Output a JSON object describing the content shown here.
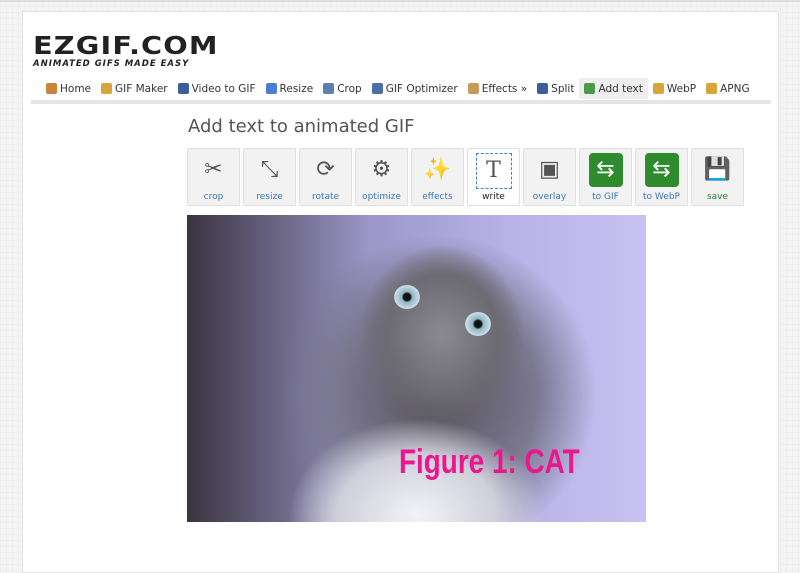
{
  "logo": {
    "name": "EZGIF.COM",
    "tagline": "ANIMATED GIFS MADE EASY"
  },
  "nav": [
    {
      "label": "Home",
      "icon": "home-icon",
      "color": "#c8843a"
    },
    {
      "label": "GIF Maker",
      "icon": "gif-maker-icon",
      "color": "#d9a53a"
    },
    {
      "label": "Video to GIF",
      "icon": "film-icon",
      "color": "#3a5f9a"
    },
    {
      "label": "Resize",
      "icon": "resize-icon",
      "color": "#4a7fd0"
    },
    {
      "label": "Crop",
      "icon": "crop-icon",
      "color": "#5a7fb0"
    },
    {
      "label": "GIF Optimizer",
      "icon": "optimizer-icon",
      "color": "#4a6fa0"
    },
    {
      "label": "Effects »",
      "icon": "effects-icon",
      "color": "#c89a5a"
    },
    {
      "label": "Split",
      "icon": "split-icon",
      "color": "#3a5f9a"
    },
    {
      "label": "Add text",
      "icon": "add-text-icon",
      "color": "#4a9a4a",
      "active": true
    },
    {
      "label": "WebP",
      "icon": "webp-icon",
      "color": "#d9a53a"
    },
    {
      "label": "APNG",
      "icon": "apng-icon",
      "color": "#d9a53a"
    }
  ],
  "page_title": "Add text to animated GIF",
  "tools": [
    {
      "label": "crop",
      "icon": "crop-knife-icon",
      "glyph": "✂"
    },
    {
      "label": "resize",
      "icon": "resize-frame-icon",
      "glyph": "⤡"
    },
    {
      "label": "rotate",
      "icon": "rotate-icon",
      "glyph": "⟳"
    },
    {
      "label": "optimize",
      "icon": "gear-broom-icon",
      "glyph": "⚙"
    },
    {
      "label": "effects",
      "icon": "magic-wand-icon",
      "glyph": "✨"
    },
    {
      "label": "write",
      "icon": "text-add-icon",
      "glyph": "T",
      "active": true
    },
    {
      "label": "overlay",
      "icon": "image-add-icon",
      "glyph": "▣"
    },
    {
      "label": "to GIF",
      "icon": "convert-arrows-icon",
      "glyph": "⇆"
    },
    {
      "label": "to WebP",
      "icon": "convert-arrows-icon",
      "glyph": "⇆"
    },
    {
      "label": "save",
      "icon": "floppy-disk-icon",
      "glyph": "💾"
    }
  ],
  "image": {
    "caption": "Figure 1: CAT",
    "caption_color": "#ec178c"
  }
}
